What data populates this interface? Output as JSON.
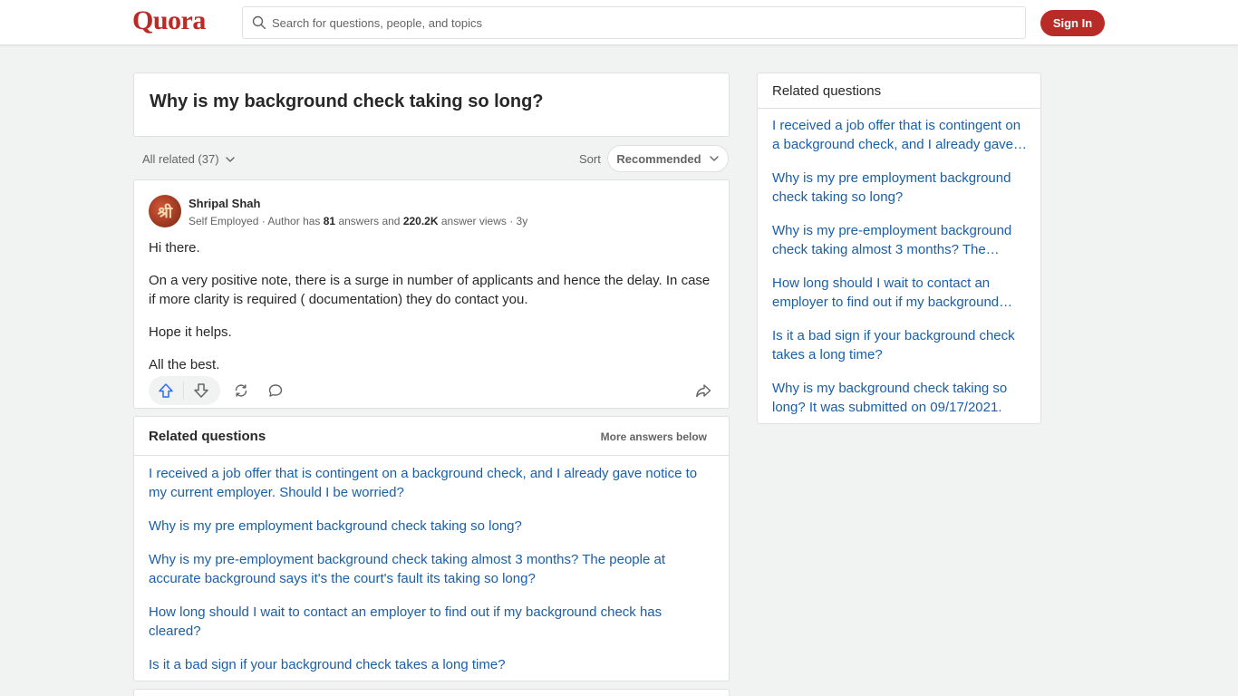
{
  "header": {
    "logo": "Quora",
    "search_placeholder": "Search for questions, people, and topics",
    "signin_label": "Sign In"
  },
  "question": {
    "title": "Why is my background check taking so long?"
  },
  "filter": {
    "all_related": "All related (37)",
    "sort_label": "Sort",
    "sort_value": "Recommended"
  },
  "answer": {
    "author": "Shripal Shah",
    "avatar_glyph": "श्री",
    "meta_prefix": "Self Employed · Author has ",
    "answers_count": "81",
    "meta_mid": " answers and ",
    "views_count": "220.2K",
    "meta_suffix": " answer views · 3y",
    "paragraphs": [
      "Hi there.",
      "On a very positive note, there is a surge in number of applicants and hence the delay. In case if more clarity is required ( documentation) they do contact you.",
      "Hope it helps.",
      "All the best."
    ]
  },
  "related_main": {
    "title": "Related questions",
    "more_answers": "More answers below",
    "items": [
      "I received a job offer that is contingent on a background check, and I already gave notice to my current employer. Should I be worried?",
      "Why is my pre employment background check taking so long?",
      "Why is my pre-employment background check taking almost 3 months? The people at accurate background says it's the court's fault its taking so long?",
      "How long should I wait to contact an employer to find out if my background check has cleared?",
      "Is it a bad sign if your background check takes a long time?"
    ]
  },
  "related_side": {
    "title": "Related questions",
    "items": [
      "I received a job offer that is contingent on a background check, and I already gave…",
      "Why is my pre employment background check taking so long?",
      "Why is my pre-employment background check taking almost 3 months? The…",
      "How long should I wait to contact an employer to find out if my background…",
      "Is it a bad sign if your background check takes a long time?",
      "Why is my background check taking so long? It was submitted on 09/17/2021."
    ]
  },
  "colors": {
    "brand": "#b92b27",
    "link": "#195faa",
    "upvote": "#2e69ff"
  }
}
